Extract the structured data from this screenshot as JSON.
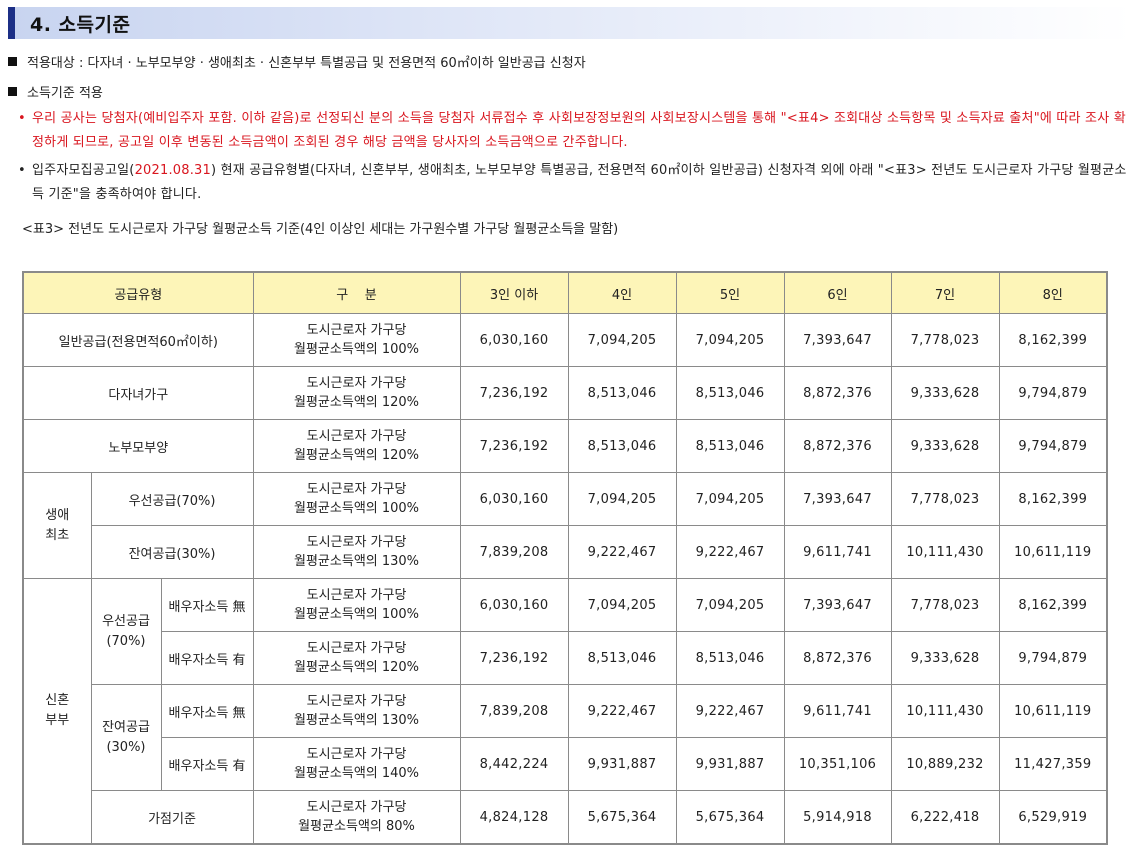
{
  "section": {
    "title": "4. 소득기준"
  },
  "bullets": {
    "target": "적용대상 : 다자녀 · 노부모부양 · 생애최초 · 신혼부부 특별공급 및 전용면적 60㎡이하 일반공급 신청자",
    "apply": "소득기준 적용"
  },
  "notes": {
    "dot": "•",
    "note1": "우리 공사는 당첨자(예비입주자 포함. 이하 같음)로 선정되신 분의 소득을 당첨자 서류접수 후 사회보장정보원의 사회보장시스템을 통해 \"<표4> 조회대상 소득항목 및 소득자료 출처\"에 따라 조사 확정하게 되므로, 공고일 이후 변동된 소득금액이 조회된 경우 해당 금액을 당사자의 소득금액으로 간주합니다.",
    "note2_pre": "입주자모집공고일(",
    "note2_date": "2021.08.31",
    "note2_post": ") 현재 공급유형별(다자녀, 신혼부부, 생애최초, 노부모부양 특별공급, 전용면적 60㎡이하 일반공급) 신청자격 외에 아래 \"<표3> 전년도 도시근로자 가구당 월평균소득 기준\"을 충족하여야 합니다."
  },
  "caption": "<표3> 전년도 도시근로자 가구당 월평균소득 기준(4인 이상인 세대는 가구원수별 가구당 월평균소득을 말함)",
  "table": {
    "headers": [
      "공급유형",
      "구    분",
      "3인 이하",
      "4인",
      "5인",
      "6인",
      "7인",
      "8인"
    ],
    "desc_line1": "도시근로자 가구당",
    "groups": {
      "first_time": "생애\n최초",
      "newlywed": "신혼\n부부",
      "priority70": "우선공급\n(70%)",
      "remaining30": "잔여공급\n(30%)"
    },
    "rows": [
      {
        "type": "일반공급(전용면적60㎡이하)",
        "desc2": "월평균소득액의 100%",
        "values": [
          "6,030,160",
          "7,094,205",
          "7,094,205",
          "7,393,647",
          "7,778,023",
          "8,162,399"
        ]
      },
      {
        "type": "다자녀가구",
        "desc2": "월평균소득액의 120%",
        "values": [
          "7,236,192",
          "8,513,046",
          "8,513,046",
          "8,872,376",
          "9,333,628",
          "9,794,879"
        ]
      },
      {
        "type": "노부모부양",
        "desc2": "월평균소득액의 120%",
        "values": [
          "7,236,192",
          "8,513,046",
          "8,513,046",
          "8,872,376",
          "9,333,628",
          "9,794,879"
        ]
      },
      {
        "type": "우선공급(70%)",
        "desc2": "월평균소득액의 100%",
        "values": [
          "6,030,160",
          "7,094,205",
          "7,094,205",
          "7,393,647",
          "7,778,023",
          "8,162,399"
        ]
      },
      {
        "type": "잔여공급(30%)",
        "desc2": "월평균소득액의 130%",
        "values": [
          "7,839,208",
          "9,222,467",
          "9,222,467",
          "9,611,741",
          "10,111,430",
          "10,611,119"
        ]
      },
      {
        "type": "배우자소득 無",
        "desc2": "월평균소득액의 100%",
        "values": [
          "6,030,160",
          "7,094,205",
          "7,094,205",
          "7,393,647",
          "7,778,023",
          "8,162,399"
        ]
      },
      {
        "type": "배우자소득 有",
        "desc2": "월평균소득액의 120%",
        "values": [
          "7,236,192",
          "8,513,046",
          "8,513,046",
          "8,872,376",
          "9,333,628",
          "9,794,879"
        ]
      },
      {
        "type": "배우자소득 無",
        "desc2": "월평균소득액의 130%",
        "values": [
          "7,839,208",
          "9,222,467",
          "9,222,467",
          "9,611,741",
          "10,111,430",
          "10,611,119"
        ]
      },
      {
        "type": "배우자소득 有",
        "desc2": "월평균소득액의 140%",
        "values": [
          "8,442,224",
          "9,931,887",
          "9,931,887",
          "10,351,106",
          "10,889,232",
          "11,427,359"
        ]
      },
      {
        "type": "가점기준",
        "desc2": "월평균소득액의 80%",
        "values": [
          "4,824,128",
          "5,675,364",
          "5,675,364",
          "5,914,918",
          "6,222,418",
          "6,529,919"
        ]
      }
    ]
  }
}
